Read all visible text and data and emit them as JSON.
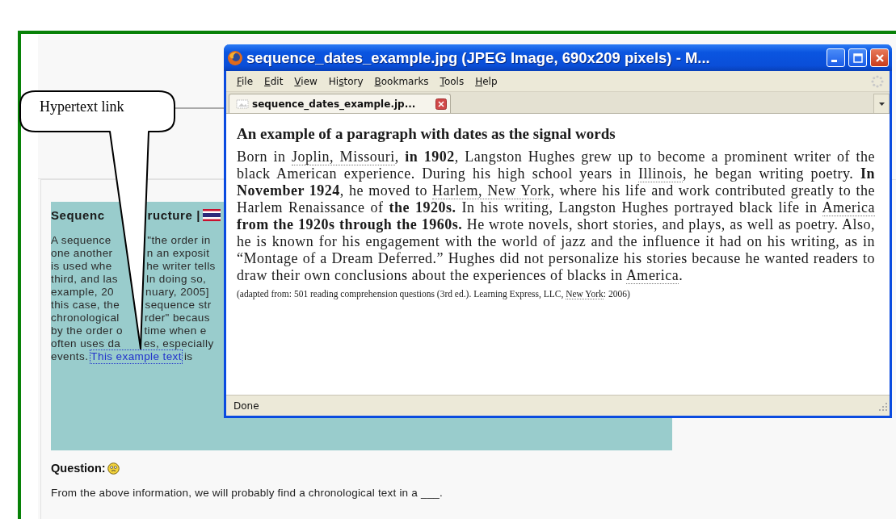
{
  "callout": {
    "text": "Hypertext link"
  },
  "lesson": {
    "heading": {
      "left": "Sequenc",
      "right": "ructure |"
    },
    "lines": [
      {
        "kind": "split",
        "left": "A sequence",
        "right": "\"the order in"
      },
      {
        "kind": "split",
        "left": "one another",
        "right": "n an exposit"
      },
      {
        "kind": "split",
        "left": "is used whe",
        "right": "he writer tells"
      },
      {
        "kind": "split",
        "left": "third, and las",
        "right": "In doing so,"
      },
      {
        "kind": "split",
        "left": "example, 20",
        "right": "nuary, 2005]"
      },
      {
        "kind": "split",
        "left": "this case, the",
        "right": "sequence str"
      },
      {
        "kind": "split",
        "left": "chronological",
        "right": "rder\" becaus"
      },
      {
        "kind": "split",
        "left": "by the order o",
        "right": "time when e"
      },
      {
        "kind": "split",
        "left": "often uses da",
        "right": "es, especially"
      },
      {
        "kind": "link",
        "before": "events.",
        "link": "This example text",
        "after": "is"
      }
    ]
  },
  "question": {
    "label": "Question:",
    "text": "From the above information, we will probably find a chronological text in a ___."
  },
  "window": {
    "title": "sequence_dates_example.jpg (JPEG Image, 690x209 pixels) - M...",
    "menus": [
      {
        "key": "F",
        "after": "ile"
      },
      {
        "key": "E",
        "after": "dit"
      },
      {
        "key": "V",
        "after": "iew"
      },
      {
        "before": "Hi",
        "key": "s",
        "after": "tory"
      },
      {
        "key": "B",
        "after": "ookmarks"
      },
      {
        "key": "T",
        "after": "ools"
      },
      {
        "key": "H",
        "after": "elp"
      }
    ],
    "tabs": [
      {
        "label": "sequence_dates_example.jp...",
        "selected": true
      }
    ],
    "document": {
      "heading": "An example of a paragraph with dates as the signal words",
      "paragraph": [
        {
          "kind": "plain",
          "text": "Born in "
        },
        {
          "kind": "place",
          "text": "Joplin, Missouri"
        },
        {
          "kind": "plain",
          "text": ", "
        },
        {
          "kind": "bold",
          "text": "in 1902"
        },
        {
          "kind": "plain",
          "text": ", Langston Hughes grew up to become a prominent writer of the black American experience. During his high school years in "
        },
        {
          "kind": "place",
          "text": "Illinois"
        },
        {
          "kind": "plain",
          "text": ", he began writing poetry. "
        },
        {
          "kind": "bold",
          "text": "In November 1924"
        },
        {
          "kind": "plain",
          "text": ", he moved to "
        },
        {
          "kind": "place",
          "text": "Harlem, New York"
        },
        {
          "kind": "plain",
          "text": ", where his life and work contributed greatly to the Harlem Renaissance of "
        },
        {
          "kind": "bold",
          "text": "the 1920s."
        },
        {
          "kind": "plain",
          "text": " In his writing, Langston Hughes portrayed black life in "
        },
        {
          "kind": "place",
          "text": "America"
        },
        {
          "kind": "bold",
          "text": " from the 1920s through the 1960s."
        },
        {
          "kind": "plain",
          "text": " He wrote novels, short stories, and plays, as well as poetry. Also, he is known for his engagement with the world of jazz and the influence it had on his writing, as in “Montage of a Dream Deferred.” Hughes did not personalize his stories because he wanted readers to draw their own conclusions about the experiences of blacks in "
        },
        {
          "kind": "place",
          "text": "America"
        },
        {
          "kind": "plain",
          "text": "."
        }
      ],
      "citation": [
        {
          "kind": "plain",
          "text": "(adapted from: 501 reading comprehension questions (3rd ed.). Learning Express, LLC, "
        },
        {
          "kind": "place",
          "text": "New York"
        },
        {
          "kind": "plain",
          "text": ": 2006)"
        }
      ]
    },
    "status": "Done"
  }
}
